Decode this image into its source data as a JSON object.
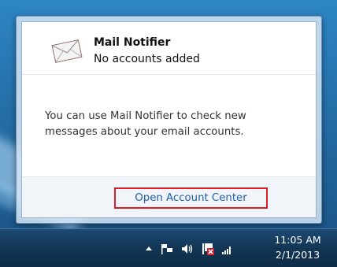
{
  "popup": {
    "app_name": "Mail Notifier",
    "status": "No accounts added",
    "message": "You can use Mail Notifier to check new messages about your email accounts.",
    "link_label": "Open Account Center",
    "link_highlight_color": "#d71f2a",
    "app_icon": "envelope-icon"
  },
  "taskbar": {
    "tray_icons": [
      "show-hidden-icons-chevron-icon",
      "action-center-flag-icon",
      "volume-speaker-icon",
      "network-error-icon",
      "wireless-signal-icon"
    ],
    "clock": {
      "time": "11:05 AM",
      "date": "2/1/2013"
    }
  }
}
